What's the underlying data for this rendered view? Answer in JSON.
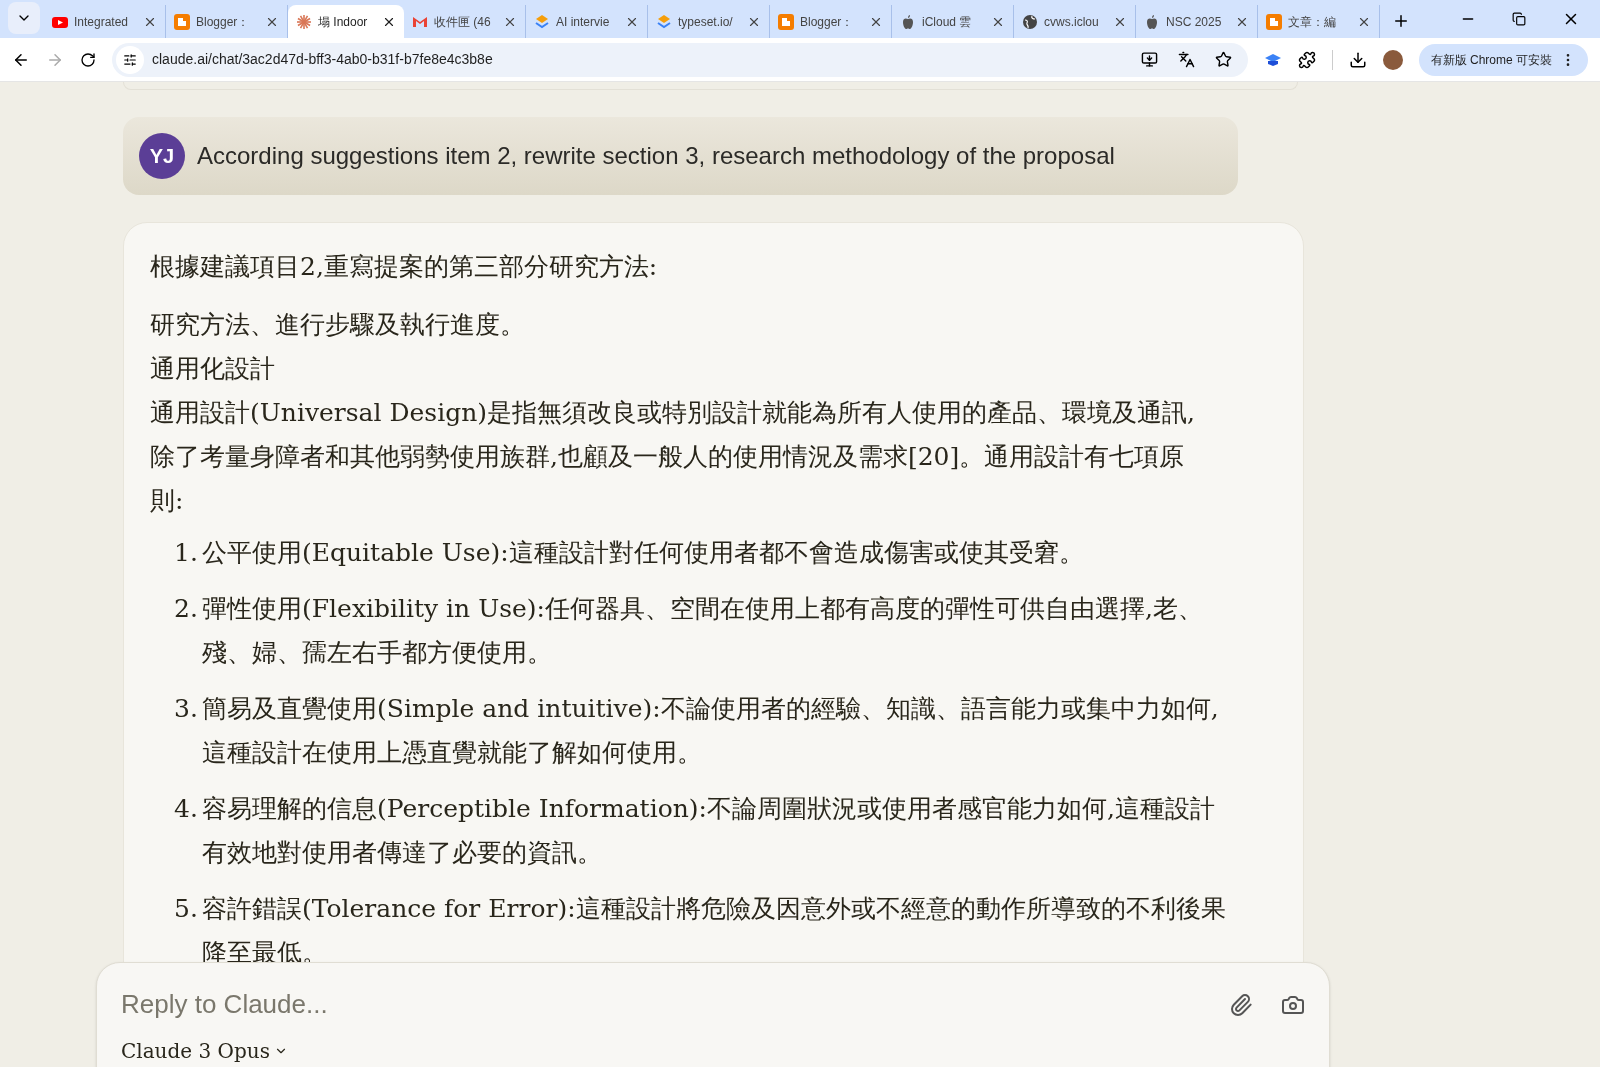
{
  "tabs": [
    {
      "title": "Integrated",
      "kind": "video",
      "selected": false
    },
    {
      "title": "Blogger：",
      "kind": "blog",
      "selected": false
    },
    {
      "title": "塌 Indoor",
      "kind": "chat",
      "selected": true
    },
    {
      "title": "收件匣 (46",
      "kind": "mail",
      "selected": false
    },
    {
      "title": "AI intervie",
      "kind": "stack",
      "selected": false
    },
    {
      "title": "typeset.io/",
      "kind": "stack",
      "selected": false
    },
    {
      "title": "Blogger：",
      "kind": "blog",
      "selected": false
    },
    {
      "title": "iCloud 雲",
      "kind": "apple",
      "selected": false
    },
    {
      "title": "cvws.iclou",
      "kind": "globe",
      "selected": false
    },
    {
      "title": "NSC 2025",
      "kind": "apple",
      "selected": false
    },
    {
      "title": "文章：編",
      "kind": "blog",
      "selected": false
    }
  ],
  "address_bar": {
    "url": "claude.ai/chat/3ac2d47d-bff3-4ab0-b31f-b7fe8e4c3b8e"
  },
  "update_button": "有新版 Chrome 可安裝",
  "user_message": {
    "avatar": "YJ",
    "text": "According suggestions item 2, rewrite section 3, research methodology of the proposal"
  },
  "response": {
    "paragraphs": [
      "根據建議項目2,重寫提案的第三部分研究方法:",
      "研究方法、進行步驟及執行進度。",
      "通用化設計",
      "通用設計(Universal Design)是指無須改良或特別設計就能為所有人使用的產品、環境及通訊,除了考量身障者和其他弱勢使用族群,也顧及一般人的使用情況及需求[20]。通用設計有七項原則:"
    ],
    "list": [
      {
        "number": "1.",
        "text": "公平使用(Equitable Use):這種設計對任何使用者都不會造成傷害或使其受窘。"
      },
      {
        "number": "2.",
        "text": "彈性使用(Flexibility in Use):任何器具、空間在使用上都有高度的彈性可供自由選擇,老、殘、婦、孺左右手都方便使用。"
      },
      {
        "number": "3.",
        "text": "簡易及直覺使用(Simple and intuitive):不論使用者的經驗、知識、語言能力或集中力如何,這種設計在使用上憑直覺就能了解如何使用。"
      },
      {
        "number": "4.",
        "text": "容易理解的信息(Perceptible Information):不論周圍狀況或使用者感官能力如何,這種設計有效地對使用者傳達了必要的資訊。"
      },
      {
        "number": "5.",
        "text": "容許錯誤(Tolerance for Error):這種設計將危險及因意外或不經意的動作所導致的不利後果降至最低。"
      }
    ]
  },
  "composer": {
    "placeholder": "Reply to Claude...",
    "model": "Claude 3 Opus"
  }
}
